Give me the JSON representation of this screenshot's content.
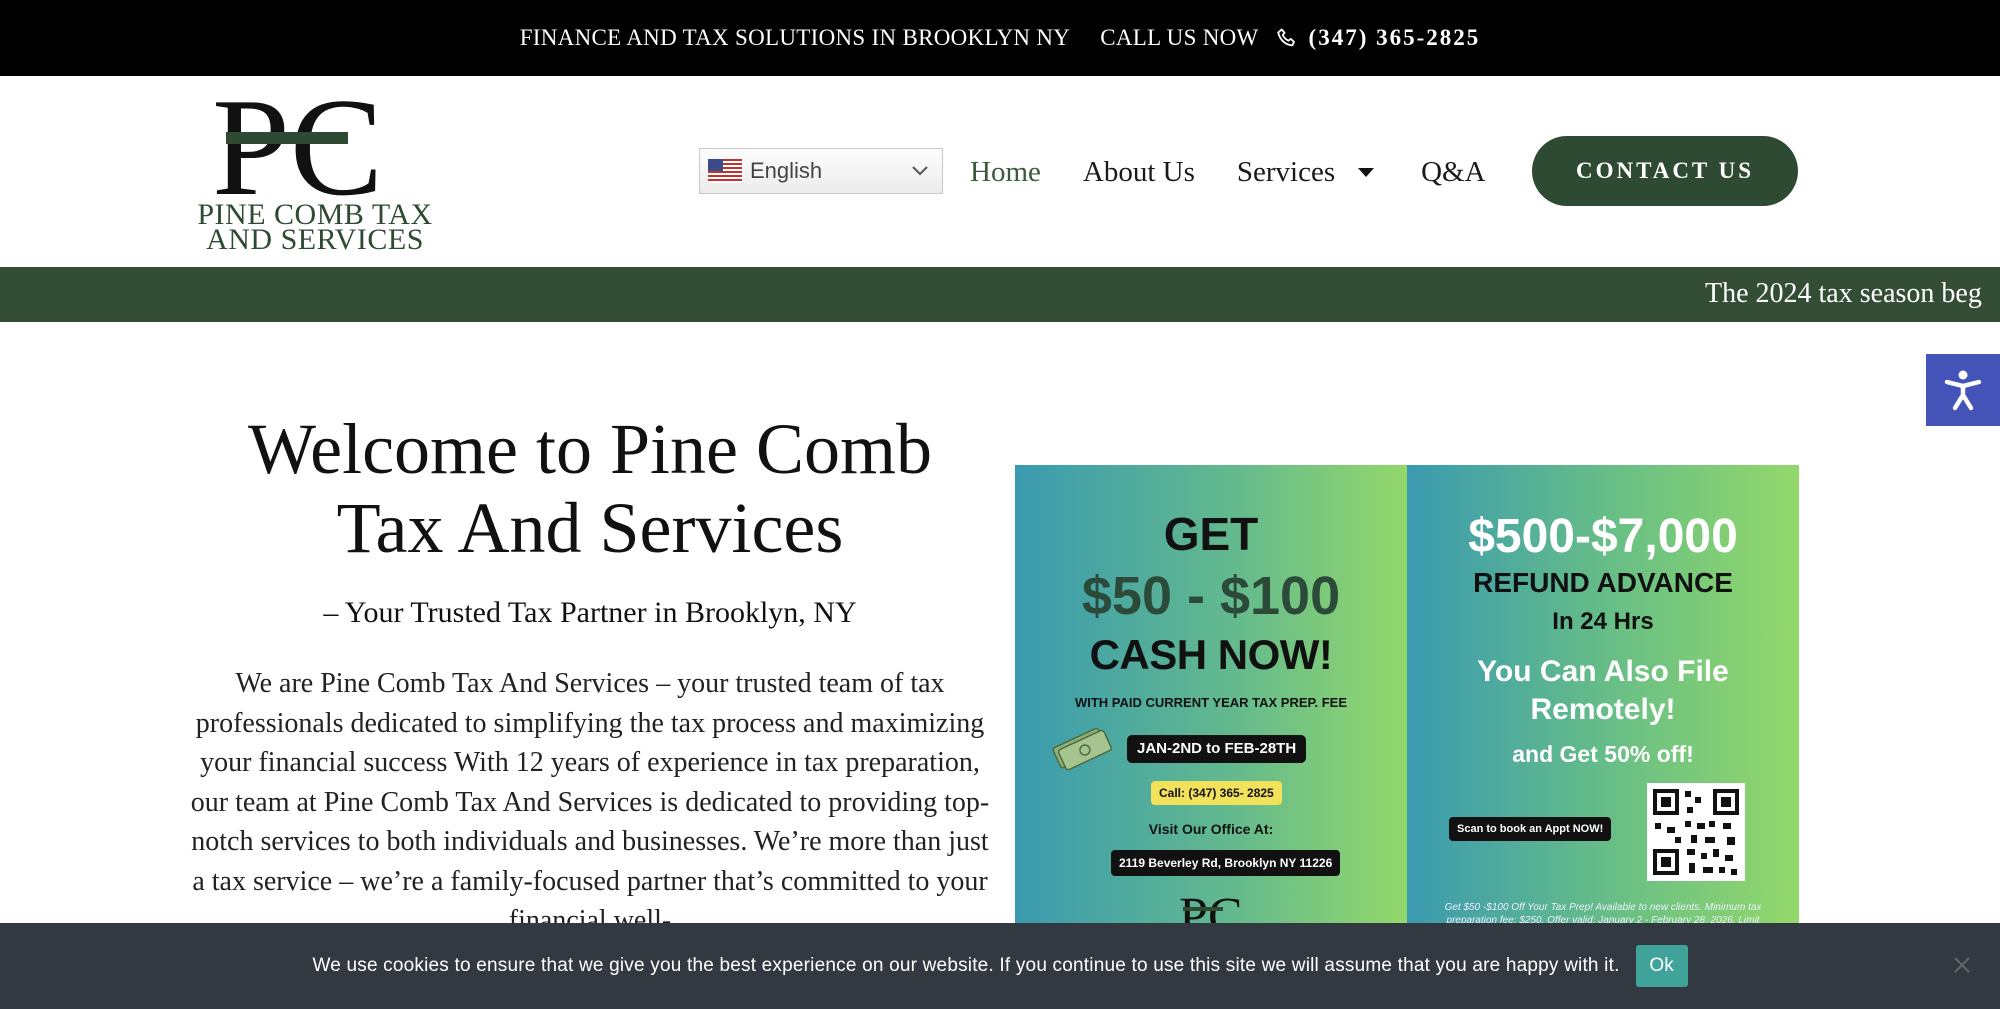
{
  "topbar": {
    "tagline": "FINANCE AND TAX SOLUTIONS IN BROOKLYN NY",
    "call_label": "CALL US NOW",
    "phone": "(347) 365-2825"
  },
  "header": {
    "logo_letters": "PC",
    "logo_line1": "PINE COMB TAX",
    "logo_line2": "AND SERVICES",
    "language": "English",
    "nav": {
      "home": "Home",
      "about": "About Us",
      "services": "Services",
      "qa": "Q&A"
    },
    "contact_button": "CONTACT US"
  },
  "ticker": {
    "text": "The 2024 tax season beg"
  },
  "main": {
    "title_line1": "Welcome to Pine Comb",
    "title_line2": "Tax And Services",
    "subtitle": "– Your Trusted Tax Partner in Brooklyn, NY",
    "paragraph": "We are Pine Comb Tax And Services – your trusted team of tax professionals dedicated to simplifying the tax process and maximizing your financial success With 12 years of experience in tax preparation, our team at Pine Comb Tax And Services is dedicated to providing top-notch services to both individuals and businesses. We’re more than just a tax service – we’re a family-focused partner that’s committed to your financial well-"
  },
  "flyer": {
    "left": {
      "get": "GET",
      "amount": "$50 - $100",
      "cash": "CASH NOW!",
      "with_fee": "WITH PAID CURRENT YEAR TAX PREP. FEE",
      "dates": "JAN-2ND to FEB-28TH",
      "call": "Call: (347) 365- 2825",
      "visit": "Visit Our Office At:",
      "address": "2119 Beverley Rd, Brooklyn NY 11226"
    },
    "right": {
      "amount": "$500-$7,000",
      "refund": "REFUND ADVANCE",
      "hours": "In 24 Hrs",
      "remote_line1": "You Can Also File",
      "remote_line2": "Remotely!",
      "discount": "and Get 50% off!",
      "scan": "Scan to book an Appt NOW!",
      "fine_print": "Get $50 -$100 Off Your Tax Prep!  Available to new clients. Minimum tax preparation fee: $250. Offer valid: January 2 - February 28, 2026. Limit"
    }
  },
  "cookie": {
    "text": "We use cookies to ensure that we give you the best experience on our website. If you continue to use this site we will assume that you are happy with it.",
    "ok": "Ok"
  },
  "colors": {
    "brand_green": "#2f4a32",
    "ticker_green": "#344e36",
    "a11y_blue": "#4353b8",
    "cookie_bg": "#333941",
    "ok_teal": "#3fa39a"
  }
}
